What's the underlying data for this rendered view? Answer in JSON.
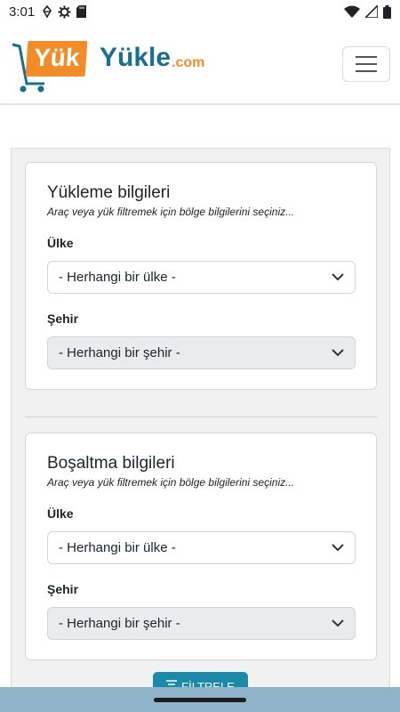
{
  "status": {
    "time": "3:01"
  },
  "logo": {
    "yuk": "Yük",
    "yukle": "Yükle",
    "dotcom": ".com"
  },
  "colors": {
    "brand_orange": "#f28c28",
    "brand_teal": "#1b6e8f",
    "button": "#1b8aa8"
  },
  "loading": {
    "title": "Yükleme bilgileri",
    "subtitle": "Araç veya yük filtremek için bölge bilgilerini seçiniz...",
    "country_label": "Ülke",
    "country_value": "- Herhangi bir ülke -",
    "city_label": "Şehir",
    "city_value": "- Herhangi bir şehir -"
  },
  "unloading": {
    "title": "Boşaltma bilgileri",
    "subtitle": "Araç veya yük filtremek için bölge bilgilerini seçiniz...",
    "country_label": "Ülke",
    "country_value": "- Herhangi bir ülke -",
    "city_label": "Şehir",
    "city_value": "- Herhangi bir şehir -"
  },
  "filter_button": {
    "label": "FİLTRELE"
  }
}
